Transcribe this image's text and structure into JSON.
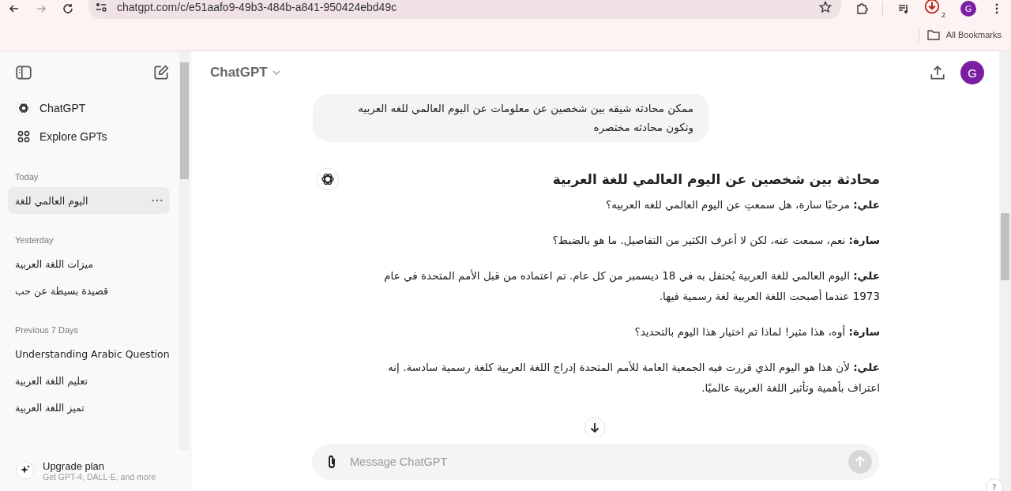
{
  "browser": {
    "url": "chatgpt.com/c/e51aafo9-49b3-484b-a841-950424ebd49c",
    "forward_disabled": true,
    "download_badge": "2",
    "profile": "G",
    "bookmarks": [
      "All Bookmarks"
    ]
  },
  "sidebar": {
    "nav": [
      {
        "kind": "logo",
        "label": "ChatGPT"
      },
      {
        "kind": "grid",
        "label": "Explore GPTs"
      }
    ],
    "sections": [
      {
        "title": "Today",
        "items": [
          {
            "label": "اليوم العالمي للغة",
            "selected": true
          }
        ]
      },
      {
        "title": "Yesterday",
        "items": [
          {
            "label": "ميزات اللغة العربية",
            "selected": false
          },
          {
            "label": "قصيدة بسيطة عن حب",
            "selected": false
          }
        ]
      },
      {
        "title": "Previous 7 Days",
        "items": [
          {
            "label": "Understanding Arabic Question",
            "selected": false
          },
          {
            "label": "تعليم اللغة العربية",
            "selected": false
          },
          {
            "label": "تميز اللغة العربية",
            "selected": false
          }
        ]
      }
    ],
    "upgrade": {
      "title": "Upgrade plan",
      "subtitle": "Get GPT-4, DALL·E, and more"
    }
  },
  "header": {
    "title": "ChatGPT",
    "avatar": "G"
  },
  "user_message": "ممكن محادثه شيقه بين شخصين عن معلومات عن اليوم العالمي للغه العربيه وتكون محادثه مختصره",
  "assistant": [
    {
      "kind": "heading",
      "text": "محادثة بين شخصين عن اليوم العالمي للغة العربية"
    },
    {
      "kind": "paragraph",
      "text": "**علي:** مرحبًا سارة، هل سمعتِ عن اليوم العالمي للغه العربيه؟"
    },
    {
      "kind": "paragraph",
      "text": "**سارة:** نعم، سمعت عنه، لكن لا أعرف الكثير من التفاصيل. ما هو بالضبط؟"
    },
    {
      "kind": "paragraph",
      "text": "**علي:** اليوم العالمي للغة العربية يُحتفل به في 18 ديسمبر من كل عام. تم اعتماده من قبل الأمم المتحدة في عام 1973 عندما أصبحت اللغة العربية لغة رسمية فيها."
    },
    {
      "kind": "paragraph",
      "text": "**سارة:** أوه، هذا مثير! لماذا تم اختيار هذا اليوم بالتحديد؟"
    },
    {
      "kind": "paragraph",
      "text": "**علي:** لأن هذا هو اليوم الذي قررت فيه الجمعية العامة للأمم المتحدة إدراج اللغة العربية كلغة رسمية سادسة. إنه اعتراف بأهمية وتأثير اللغة العربية عالميًا."
    }
  ],
  "composer": {
    "placeholder": "Message ChatGPT",
    "send_disabled": true
  },
  "help": "?"
}
